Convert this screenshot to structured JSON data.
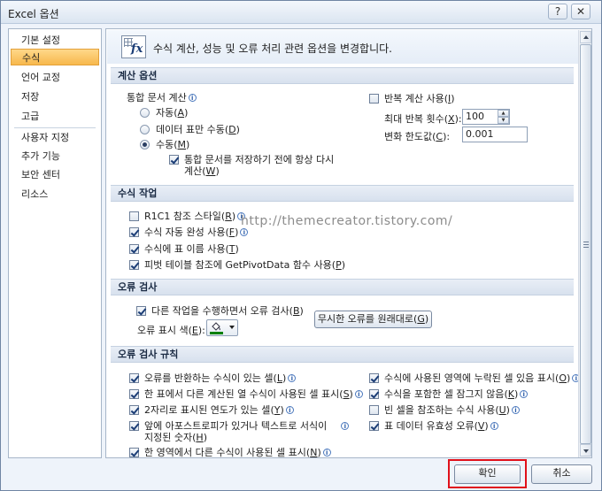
{
  "window": {
    "title": "Excel 옵션",
    "help_glyph": "?",
    "close_glyph": "✕"
  },
  "nav": {
    "items": [
      "기본 설정",
      "수식",
      "언어 교정",
      "저장",
      "고급",
      "사용자 지정",
      "추가 기능",
      "보안 센터",
      "리소스"
    ],
    "selected": "수식"
  },
  "header": {
    "text": "수식 계산, 성능 및 오류 처리 관련 옵션을 변경합니다.",
    "icon": "formula-fx-icon"
  },
  "calc": {
    "title": "계산 옵션",
    "workbook_label": "통합 문서 계산",
    "radios": [
      {
        "label": "자동",
        "key": "A",
        "checked": false
      },
      {
        "label": "데이터 표만 수동",
        "key": "D",
        "checked": false
      },
      {
        "label": "수동",
        "key": "M",
        "checked": true
      }
    ],
    "recalc_before_save": "통합 문서를 저장하기 전에 항상 다시",
    "recalc_before_save_2": "계산",
    "recalc_before_save_key": "W",
    "iterative_label": "반복 계산 사용",
    "iterative_key": "I",
    "max_iter_label": "최대 반복 횟수",
    "max_iter_key": "X",
    "max_iter_value": "100",
    "max_change_label": "변화 한도값",
    "max_change_key": "C",
    "max_change_value": "0.001"
  },
  "formula": {
    "title": "수식 작업",
    "items": [
      {
        "label": "R1C1 참조 스타일",
        "key": "R",
        "checked": false
      },
      {
        "label": "수식 자동 완성 사용",
        "key": "F",
        "checked": true
      },
      {
        "label": "수식에 표 이름 사용",
        "key": "T",
        "checked": true
      },
      {
        "label": "피벗 테이블 참조에 GetPivotData 함수 사용",
        "key": "P",
        "checked": true
      }
    ]
  },
  "error_check": {
    "title": "오류 검사",
    "background_label": "다른 작업을 수행하면서 오류 검사",
    "background_key": "B",
    "color_label": "오류 표시 색",
    "color_key": "E",
    "color_value": "#008000",
    "reset_button": "무시한 오류를 원래대로",
    "reset_key": "G"
  },
  "rules": {
    "title": "오류 검사 규칙",
    "left": [
      {
        "label": "오류를 반환하는 수식이 있는 셀",
        "key": "L",
        "checked": true
      },
      {
        "label": "한 표에서 다른 계산된 열 수식이 사용된 셀 표시",
        "key": "S",
        "checked": true
      },
      {
        "label": "2자리로 표시된 연도가 있는 셀",
        "key": "Y",
        "checked": true
      },
      {
        "label": "앞에 아포스트로피가 있거나 텍스트로 서식이",
        "label2": "지정된 숫자",
        "key": "H",
        "checked": true
      },
      {
        "label": "한 영역에서 다른 수식이 사용된 셀 표시",
        "key": "N",
        "checked": true
      }
    ],
    "right": [
      {
        "label": "수식에 사용된 영역에 누락된 셀 있음 표시",
        "key": "O",
        "checked": true
      },
      {
        "label": "수식을 포함한 셀 잠그지 않음",
        "key": "K",
        "checked": true
      },
      {
        "label": "빈 셀을 참조하는 수식 사용",
        "key": "U",
        "checked": false
      },
      {
        "label": "표 데이터 유효성 오류",
        "key": "V",
        "checked": true
      }
    ]
  },
  "watermark": "http://themecreator.tistory.com/",
  "footer": {
    "ok": "확인",
    "cancel": "취소"
  },
  "colors": {
    "highlight": "#e0101a",
    "accent": "#f7b84c"
  }
}
